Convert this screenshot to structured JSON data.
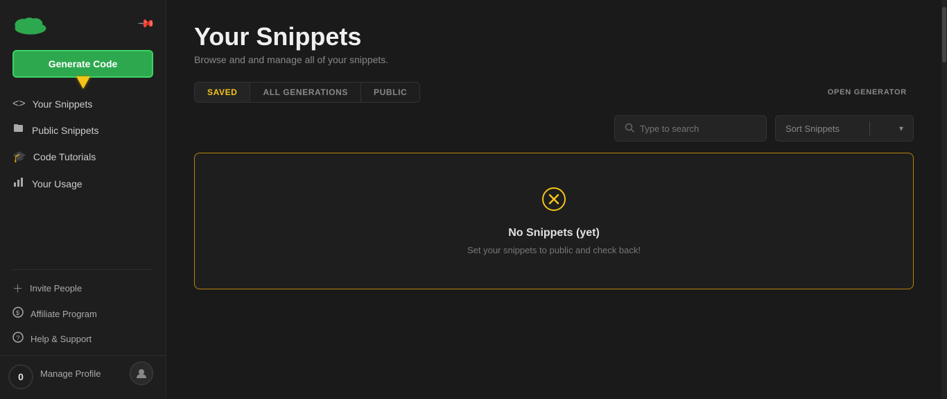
{
  "sidebar": {
    "logo_alt": "Logo",
    "generate_btn_label": "Generate Code",
    "nav_items": [
      {
        "id": "your-snippets",
        "label": "Your Snippets",
        "icon": "code"
      },
      {
        "id": "public-snippets",
        "label": "Public Snippets",
        "icon": "folder"
      },
      {
        "id": "code-tutorials",
        "label": "Code Tutorials",
        "icon": "graduation"
      },
      {
        "id": "your-usage",
        "label": "Your Usage",
        "icon": "bar-chart"
      }
    ],
    "bottom_items": [
      {
        "id": "invite-people",
        "label": "Invite People",
        "icon": "plus"
      },
      {
        "id": "affiliate-program",
        "label": "Affiliate Program",
        "icon": "dollar"
      },
      {
        "id": "help-support",
        "label": "Help & Support",
        "icon": "question"
      }
    ],
    "profile_label": "Manage Profile",
    "notification_count": "0"
  },
  "main": {
    "page_title": "Your Snippets",
    "page_subtitle": "Browse and and manage all of your snippets.",
    "tabs": [
      {
        "id": "saved",
        "label": "SAVED",
        "active": true
      },
      {
        "id": "all-generations",
        "label": "ALL GENERATIONS",
        "active": false
      },
      {
        "id": "public",
        "label": "PUBLIC",
        "active": false
      }
    ],
    "open_generator_label": "OPEN GENERATOR",
    "search_placeholder": "Type to search",
    "sort_label": "Sort Snippets",
    "empty_state": {
      "title": "No Snippets (yet)",
      "subtitle": "Set your snippets to public and check back!"
    }
  }
}
